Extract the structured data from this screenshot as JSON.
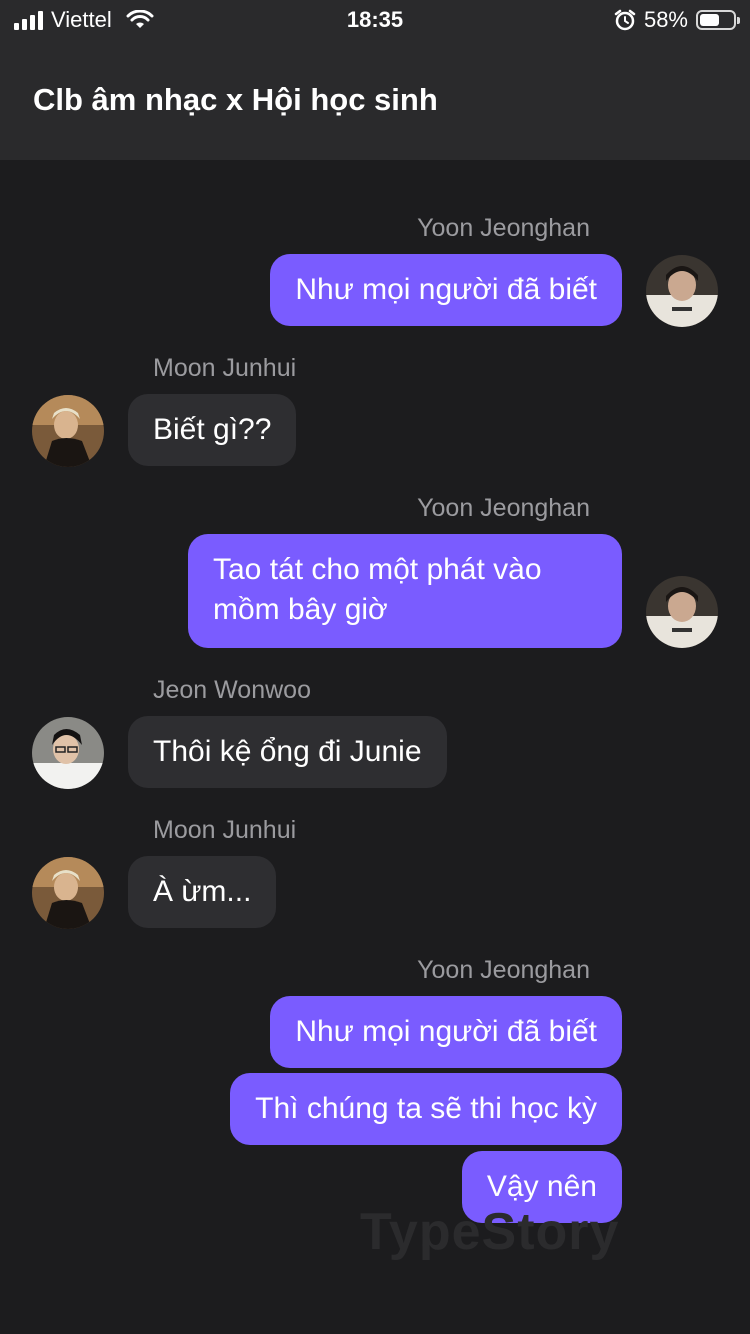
{
  "status_bar": {
    "carrier": "Viettel",
    "time": "18:35",
    "battery": "58%",
    "battery_level": 0.58,
    "icons": [
      "signal-icon",
      "wifi-icon",
      "alarm-icon",
      "battery-icon"
    ]
  },
  "header": {
    "title": "Clb âm nhạc x Hội học sinh"
  },
  "colors": {
    "background": "#1c1c1e",
    "header": "#2a2a2c",
    "outgoing_bubble": "#7a5cff",
    "incoming_bubble": "#2e2e31",
    "sender_name": "#9b9b9f"
  },
  "messages": [
    {
      "sender": "Yoon Jeonghan",
      "side": "right",
      "text": "Như mọi người đã biết"
    },
    {
      "sender": "Moon Junhui",
      "side": "left",
      "text": "Biết gì??"
    },
    {
      "sender": "Yoon Jeonghan",
      "side": "right",
      "text": "Tao tát cho một phát vào mồm bây giờ"
    },
    {
      "sender": "Jeon Wonwoo",
      "side": "left",
      "text": "Thôi kệ ổng đi Junie"
    },
    {
      "sender": "Moon Junhui",
      "side": "left",
      "text": "À ừm..."
    },
    {
      "sender": "Yoon Jeonghan",
      "side": "right",
      "texts": [
        "Như mọi người đã biết",
        "Thì chúng ta sẽ thi học kỳ",
        "Vậy nên"
      ]
    }
  ],
  "watermark": "TypeStory"
}
